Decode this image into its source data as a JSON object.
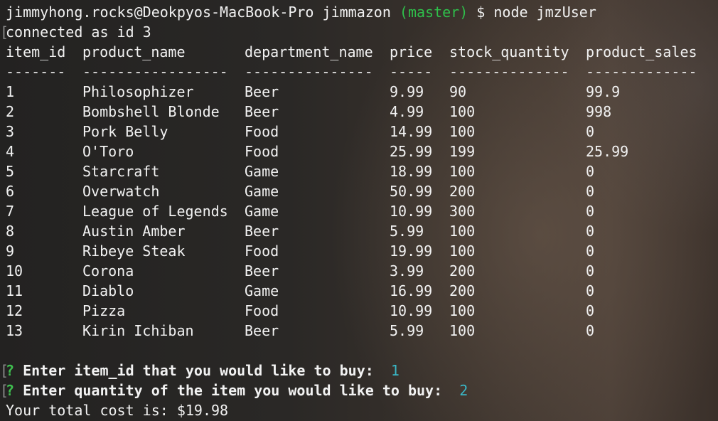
{
  "prompt": {
    "user_host": "jimmyhong.rocks@Deokpyos-MacBook-Pro",
    "dir": "jimmazon",
    "branch": "(master)",
    "symbol": "$",
    "command": "node jmzUser"
  },
  "status": "connected as id 3",
  "table": {
    "headers": [
      "item_id",
      "product_name",
      "department_name",
      "price",
      "stock_quantity",
      "product_sales"
    ],
    "separators": [
      "-------",
      "-----------------",
      "---------------",
      "-----",
      "--------------",
      "-------------"
    ],
    "rows": [
      [
        "1",
        "Philosophizer",
        "Beer",
        "9.99",
        "90",
        "99.9"
      ],
      [
        "2",
        "Bombshell Blonde",
        "Beer",
        "4.99",
        "100",
        "998"
      ],
      [
        "3",
        "Pork Belly",
        "Food",
        "14.99",
        "100",
        "0"
      ],
      [
        "4",
        "O'Toro",
        "Food",
        "25.99",
        "199",
        "25.99"
      ],
      [
        "5",
        "Starcraft",
        "Game",
        "18.99",
        "100",
        "0"
      ],
      [
        "6",
        "Overwatch",
        "Game",
        "50.99",
        "200",
        "0"
      ],
      [
        "7",
        "League of Legends",
        "Game",
        "10.99",
        "300",
        "0"
      ],
      [
        "8",
        "Austin Amber",
        "Beer",
        "5.99",
        "100",
        "0"
      ],
      [
        "9",
        "Ribeye Steak",
        "Food",
        "19.99",
        "100",
        "0"
      ],
      [
        "10",
        "Corona",
        "Beer",
        "3.99",
        "200",
        "0"
      ],
      [
        "11",
        "Diablo",
        "Game",
        "16.99",
        "200",
        "0"
      ],
      [
        "12",
        "Pizza",
        "Food",
        "10.99",
        "100",
        "0"
      ],
      [
        "13",
        "Kirin Ichiban",
        "Beer",
        "5.99",
        "100",
        "0"
      ]
    ]
  },
  "questions": [
    {
      "mark": "?",
      "text": "Enter item_id that you would like to buy:",
      "answer": "1"
    },
    {
      "mark": "?",
      "text": "Enter quantity of the item you would like to buy:",
      "answer": "2"
    }
  ],
  "result": "Your total cost is: $19.98",
  "colors": {
    "branch": "#2fbf4b",
    "question_mark": "#3fbf4f",
    "answer": "#3ab7c6"
  }
}
